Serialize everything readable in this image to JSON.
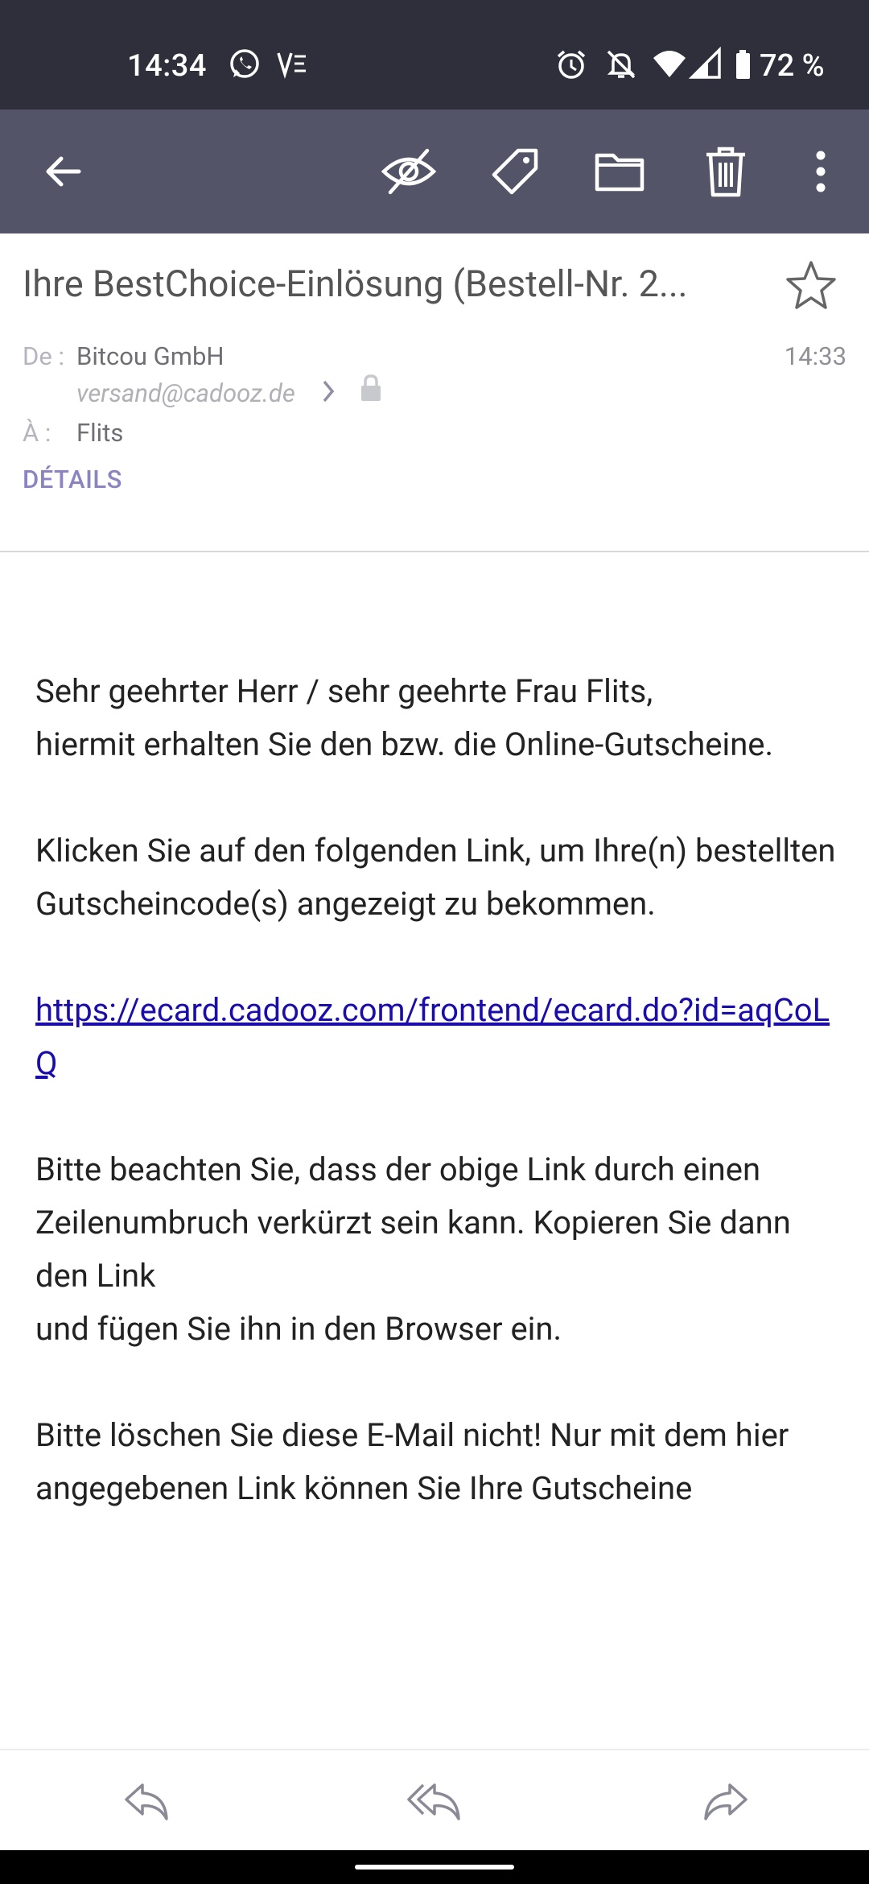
{
  "status_bar": {
    "time": "14:34",
    "battery": "72 %",
    "icons": [
      "whatsapp-icon",
      "volte-icon",
      "alarm-icon",
      "mute-icon",
      "wifi-icon",
      "signal-icon",
      "battery-icon"
    ]
  },
  "toolbar": {
    "buttons": [
      "back-icon",
      "mark-unread-icon",
      "label-icon",
      "move-to-folder-icon",
      "delete-icon",
      "more-icon"
    ],
    "bg_color": "#545468"
  },
  "header": {
    "subject": "Ihre BestChoice-Einlösung (Bestell-Nr. 2...",
    "from_label": "De :",
    "from_name": "Bitcou GmbH",
    "from_email": "versand@cadooz.de",
    "time": "14:33",
    "to_label": "À :",
    "to_name": "Flits",
    "details_label": "DÉTAILS"
  },
  "body": {
    "p1": [
      "Sehr geehrter Herr / sehr geehrte Frau Flits,",
      "hiermit erhalten Sie den bzw. die Online-Gutscheine."
    ],
    "p2": [
      "Klicken Sie auf den folgenden Link, um Ihre(n) bestellten",
      "Gutscheincode(s) angezeigt zu bekommen."
    ],
    "link": "https://ecard.cadooz.com/frontend/ecard.do?id=aqCoLQ",
    "p3": [
      "Bitte beachten Sie, dass der obige Link durch einen",
      "Zeilenumbruch verkürzt sein kann. Kopieren Sie dann den Link",
      "und fügen Sie ihn in den Browser ein."
    ],
    "p4": [
      "Bitte löschen Sie diese E-Mail nicht! Nur mit dem hier",
      "angegebenen Link können Sie Ihre Gutscheine"
    ]
  },
  "action_bar": {
    "buttons": [
      "reply-icon",
      "reply-all-icon",
      "forward-icon"
    ]
  }
}
